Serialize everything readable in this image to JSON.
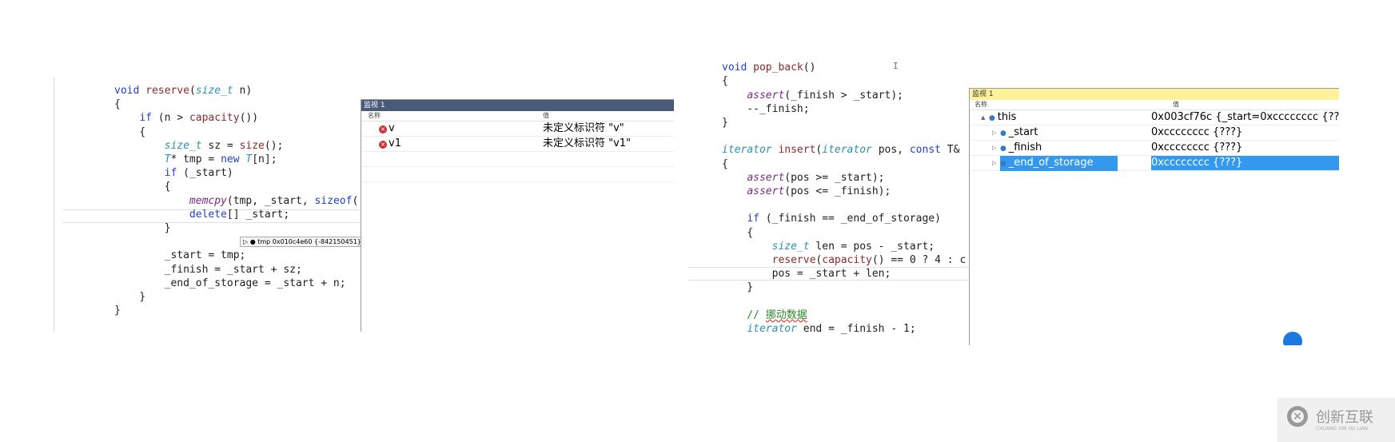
{
  "left": {
    "code": [
      [
        [
          "void ",
          "kw"
        ],
        [
          "reserve",
          "fn"
        ],
        [
          "(",
          ""
        ],
        [
          "size_t",
          "ty"
        ],
        [
          " n)",
          ""
        ]
      ],
      [
        [
          "{",
          ""
        ]
      ],
      [
        [
          "    ",
          ""
        ],
        [
          "if",
          "kw"
        ],
        [
          " (n > ",
          ""
        ],
        [
          "capacity",
          "fn"
        ],
        [
          "())",
          ""
        ]
      ],
      [
        [
          "    {",
          ""
        ]
      ],
      [
        [
          "        ",
          ""
        ],
        [
          "size_t",
          "ty"
        ],
        [
          " sz = ",
          ""
        ],
        [
          "size",
          "fn"
        ],
        [
          "();",
          ""
        ]
      ],
      [
        [
          "        ",
          ""
        ],
        [
          "T",
          "ty"
        ],
        [
          "* tmp = ",
          ""
        ],
        [
          "new",
          "kw"
        ],
        [
          " ",
          ""
        ],
        [
          "T",
          "ty"
        ],
        [
          "[n];",
          ""
        ]
      ],
      [
        [
          "        ",
          ""
        ],
        [
          "if",
          "kw"
        ],
        [
          " (_start)",
          ""
        ]
      ],
      [
        [
          "        {",
          ""
        ]
      ],
      [
        [
          "            ",
          ""
        ],
        [
          "memcpy",
          "mac"
        ],
        [
          "(tmp, _start, ",
          ""
        ],
        [
          "sizeof",
          "kw"
        ],
        [
          "(",
          ""
        ]
      ],
      [
        [
          "            ",
          ""
        ],
        [
          "delete",
          "kw"
        ],
        [
          "[] _start;",
          ""
        ]
      ],
      [
        [
          "        }",
          ""
        ]
      ],
      [
        [
          "",
          ""
        ]
      ],
      [
        [
          "        _start = tmp;",
          ""
        ]
      ],
      [
        [
          "        _finish = _start + sz;",
          ""
        ]
      ],
      [
        [
          "        _end_of_storage = _start + n;",
          ""
        ]
      ],
      [
        [
          "    }",
          ""
        ]
      ],
      [
        [
          "}",
          ""
        ]
      ]
    ],
    "tooltip": {
      "name": "tmp",
      "value": "0x010c4e60 {-842150451}"
    },
    "watch": {
      "title": "监视 1",
      "col_name": "名称",
      "col_value": "值",
      "rows": [
        {
          "name": "v",
          "value": "未定义标识符 \"v\"",
          "icon": "error-icon"
        },
        {
          "name": "v1",
          "value": "未定义标识符 \"v1\"",
          "icon": "error-icon"
        }
      ],
      "header_color": "#4a5a7a"
    }
  },
  "right": {
    "code": [
      [
        [
          "-",
          ""
        ]
      ],
      [
        [
          "void ",
          "kw"
        ],
        [
          "pop_back",
          "fn"
        ],
        [
          "()",
          ""
        ]
      ],
      [
        [
          "{",
          ""
        ]
      ],
      [
        [
          "    ",
          ""
        ],
        [
          "assert",
          "mac"
        ],
        [
          "(_finish > _start);",
          ""
        ]
      ],
      [
        [
          "    --_finish;",
          ""
        ]
      ],
      [
        [
          "}",
          ""
        ]
      ],
      [
        [
          "",
          ""
        ]
      ],
      [
        [
          "iterator",
          "ty"
        ],
        [
          " ",
          ""
        ],
        [
          "insert",
          "fn"
        ],
        [
          "(",
          ""
        ],
        [
          "iterator",
          "ty"
        ],
        [
          " pos, ",
          ""
        ],
        [
          "const",
          "kw"
        ],
        [
          " T&",
          ""
        ]
      ],
      [
        [
          "{",
          ""
        ]
      ],
      [
        [
          "    ",
          ""
        ],
        [
          "assert",
          "mac"
        ],
        [
          "(pos >= _start);",
          ""
        ]
      ],
      [
        [
          "    ",
          ""
        ],
        [
          "assert",
          "mac"
        ],
        [
          "(pos <= _finish);",
          ""
        ]
      ],
      [
        [
          "",
          ""
        ]
      ],
      [
        [
          "    ",
          ""
        ],
        [
          "if",
          "kw"
        ],
        [
          " (_finish == _end_of_storage)",
          ""
        ]
      ],
      [
        [
          "    {",
          ""
        ]
      ],
      [
        [
          "        ",
          ""
        ],
        [
          "size_t",
          "ty"
        ],
        [
          " len = pos - _start;",
          ""
        ]
      ],
      [
        [
          "        ",
          ""
        ],
        [
          "reserve",
          "fn"
        ],
        [
          "(",
          ""
        ],
        [
          "capacity",
          "fn"
        ],
        [
          "() == 0 ? 4 : c",
          ""
        ]
      ],
      [
        [
          "        pos = _start + len;",
          ""
        ]
      ],
      [
        [
          "    }",
          ""
        ]
      ],
      [
        [
          "",
          ""
        ]
      ],
      [
        [
          "    // ",
          "cm"
        ],
        [
          "挪动数据",
          "cmcn"
        ]
      ],
      [
        [
          "    ",
          ""
        ],
        [
          "iterator",
          "ty"
        ],
        [
          " end = _finish - 1;",
          ""
        ]
      ]
    ],
    "watch": {
      "title": "监视 1",
      "col_name": "名称",
      "col_value": "值",
      "rows": [
        {
          "name": "this",
          "value": "0x003cf76c {_start=0xcccccccc {???} _",
          "expander": "▲",
          "selected": false
        },
        {
          "name": "_start",
          "value": "0xcccccccc {???}",
          "expander": "▷",
          "selected": false
        },
        {
          "name": "_finish",
          "value": "0xcccccccc {???}",
          "expander": "▷",
          "selected": false
        },
        {
          "name": "_end_of_storage",
          "value": "0xcccccccc {???}",
          "expander": "▷",
          "selected": true
        }
      ],
      "header_color": "#fdf29a",
      "selection_color": "#3399ee"
    }
  },
  "watermark": {
    "brand_cn": "创新互联",
    "brand_en": "CHUANG XIN HU LIAN"
  }
}
